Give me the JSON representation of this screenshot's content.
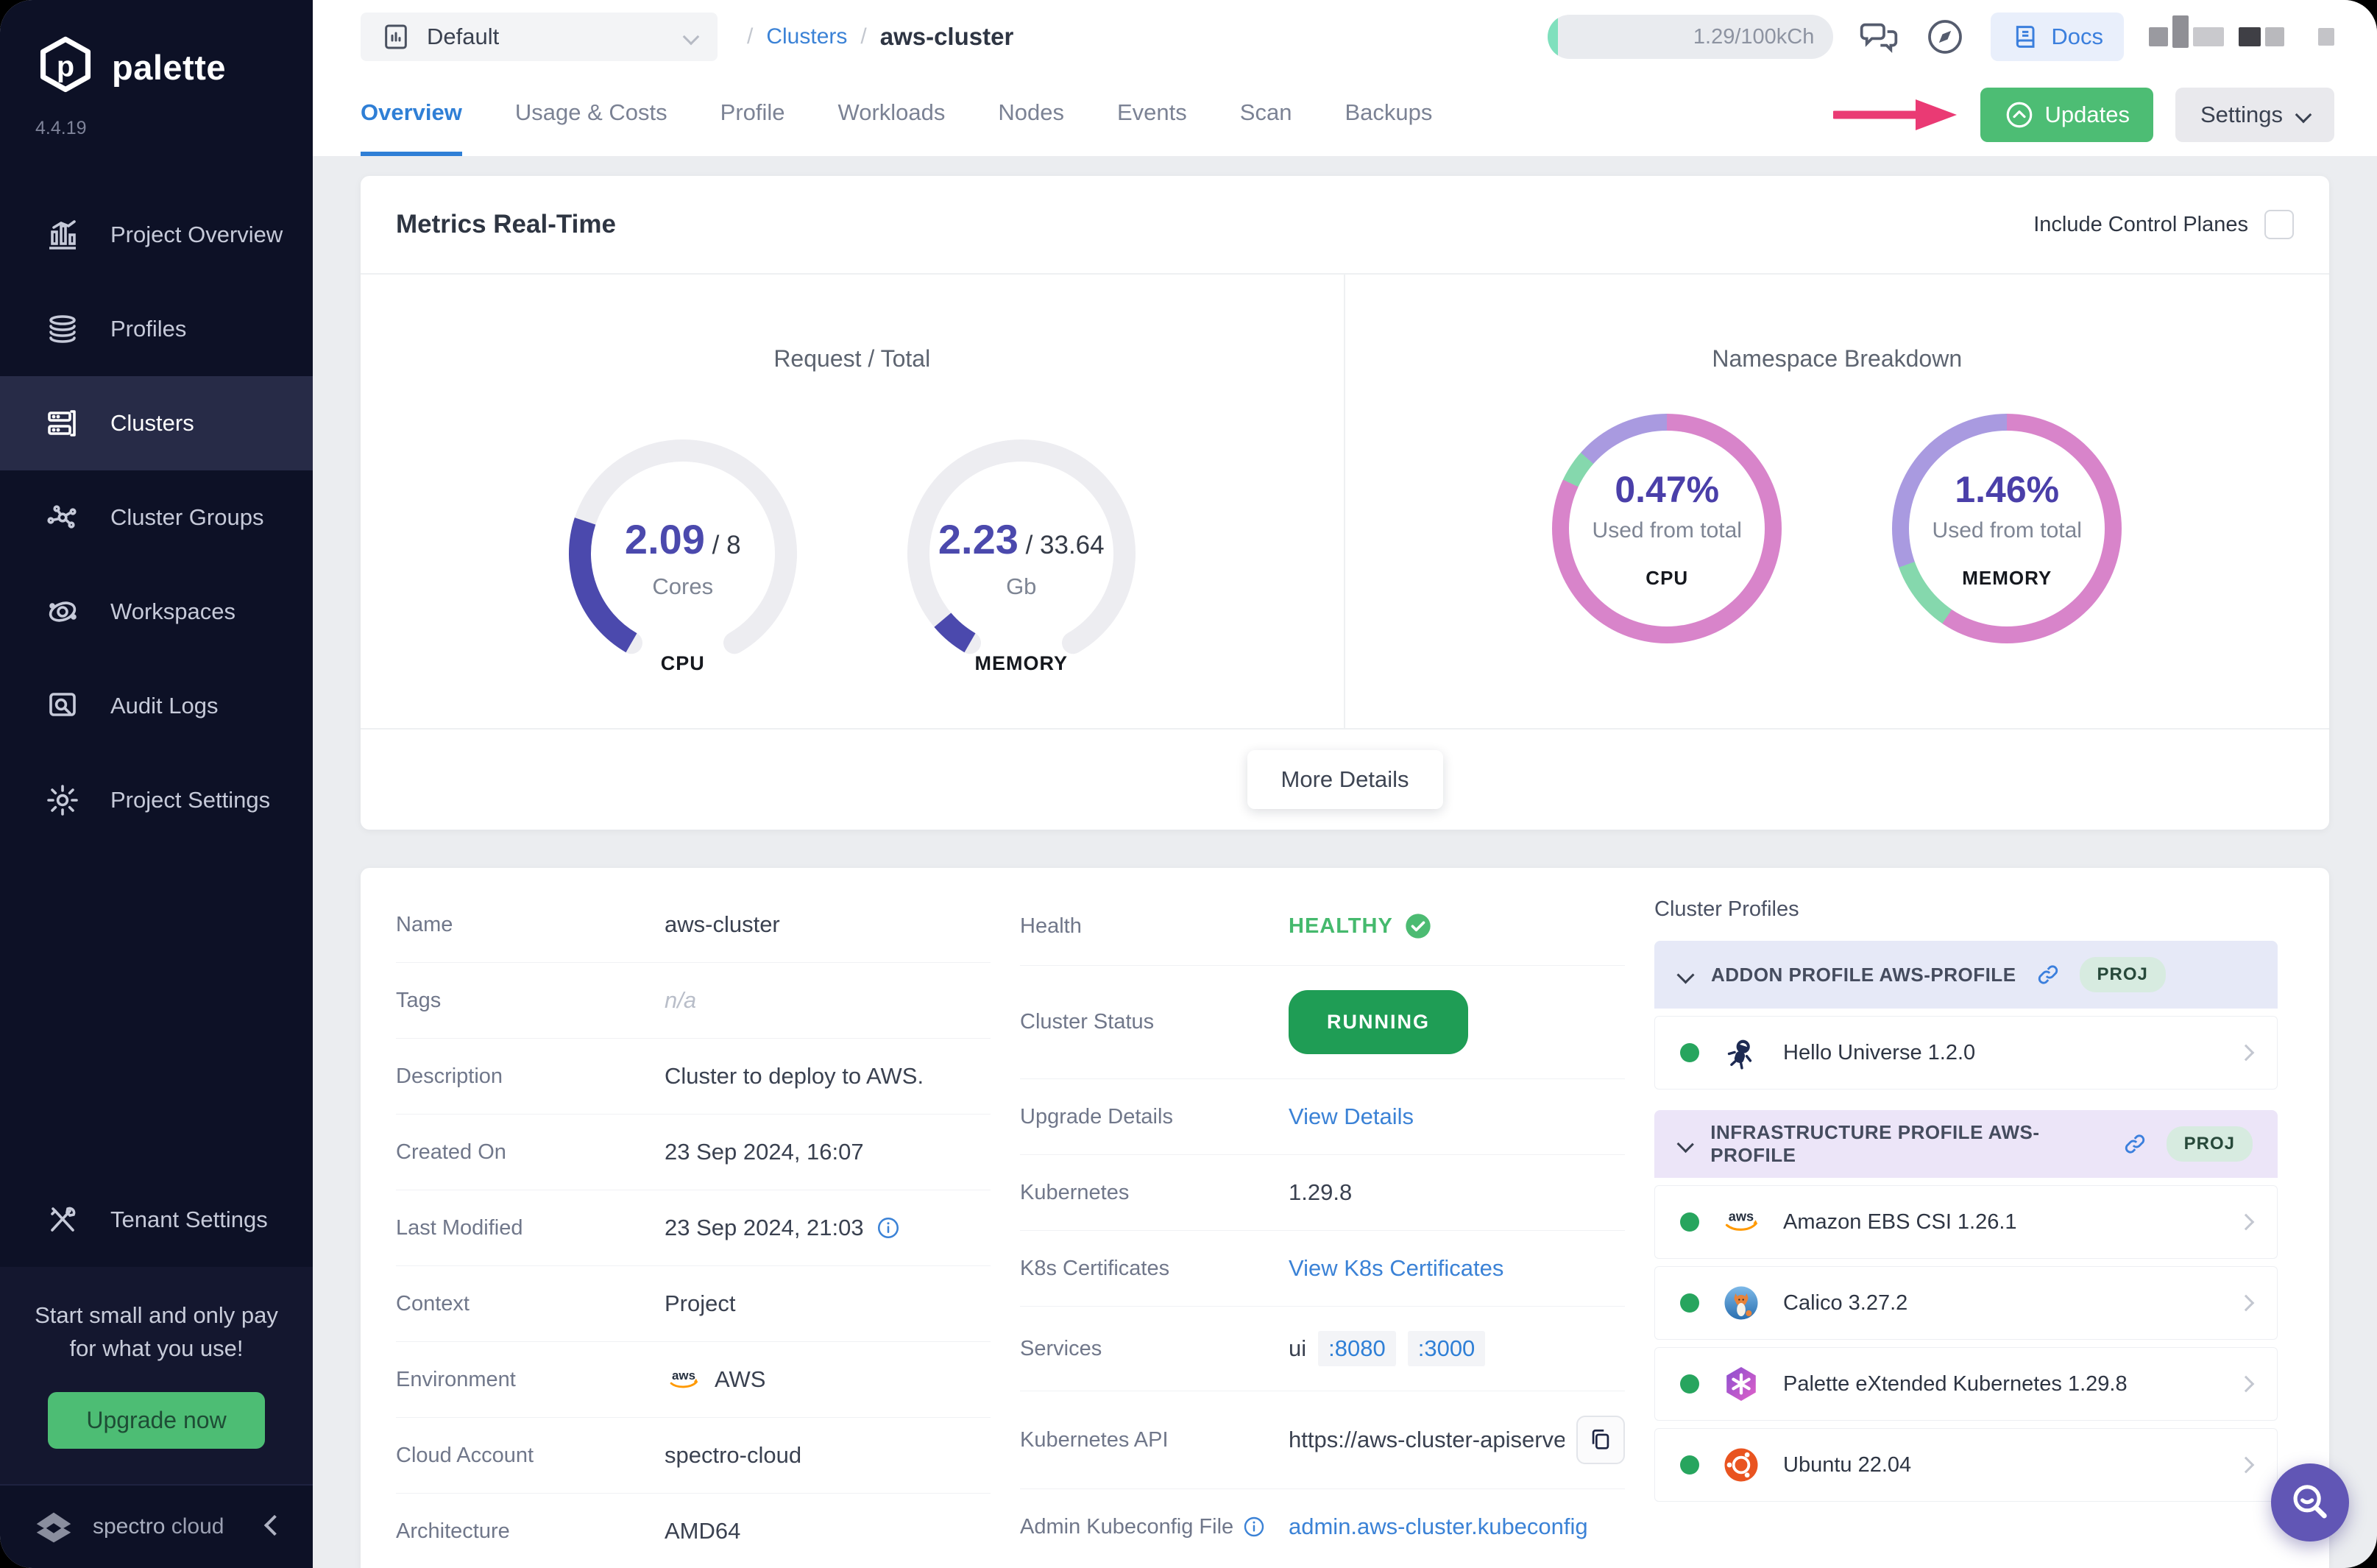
{
  "brand": {
    "name": "palette",
    "version": "4.4.19",
    "footer_primary": "spectro",
    "footer_secondary": "cloud"
  },
  "sidebar": {
    "items": [
      {
        "label": "Project Overview"
      },
      {
        "label": "Profiles"
      },
      {
        "label": "Clusters"
      },
      {
        "label": "Cluster Groups"
      },
      {
        "label": "Workspaces"
      },
      {
        "label": "Audit Logs"
      },
      {
        "label": "Project Settings"
      }
    ],
    "tenant_settings": "Tenant Settings",
    "promo": {
      "line1": "Start small and only pay",
      "line2": "for what you use!",
      "cta": "Upgrade now"
    }
  },
  "topbar": {
    "project_selector": "Default",
    "breadcrumb": {
      "sep": "/",
      "section": "Clusters",
      "current": "aws-cluster"
    },
    "usage_pill": "1.29/100kCh",
    "docs": "Docs"
  },
  "tabs": [
    "Overview",
    "Usage & Costs",
    "Profile",
    "Workloads",
    "Nodes",
    "Events",
    "Scan",
    "Backups"
  ],
  "actions": {
    "updates": "Updates",
    "settings": "Settings"
  },
  "metrics": {
    "title": "Metrics Real-Time",
    "include_control_planes": "Include Control Planes",
    "request_total": {
      "title": "Request / Total",
      "gauges": [
        {
          "value": 2.09,
          "total": 8,
          "value_str": "2.09",
          "total_str": " / 8",
          "unit": "Cores",
          "label": "CPU",
          "color": "#4b49ad"
        },
        {
          "value": 2.23,
          "total": 33.64,
          "value_str": "2.23",
          "total_str": " / 33.64",
          "unit": "Gb",
          "label": "MEMORY",
          "color": "#4b49ad"
        }
      ]
    },
    "namespace_breakdown": {
      "title": "Namespace Breakdown",
      "donuts": [
        {
          "percent": "0.47%",
          "caption": "Used from total",
          "label": "CPU",
          "segments": [
            {
              "color": "#d884ca",
              "from": 0,
              "to": 82
            },
            {
              "color": "#85d8ad",
              "from": 82,
              "to": 86.5
            },
            {
              "color": "#a99ae0",
              "from": 86.5,
              "to": 100
            }
          ]
        },
        {
          "percent": "1.46%",
          "caption": "Used from total",
          "label": "MEMORY",
          "segments": [
            {
              "color": "#d884ca",
              "from": 0,
              "to": 59.5
            },
            {
              "color": "#85d8ad",
              "from": 59.5,
              "to": 69.5
            },
            {
              "color": "#a99ae0",
              "from": 69.5,
              "to": 100
            }
          ]
        }
      ]
    },
    "more_details": "More Details"
  },
  "details": {
    "name": {
      "label": "Name",
      "value": "aws-cluster"
    },
    "tags": {
      "label": "Tags",
      "value": "n/a"
    },
    "description": {
      "label": "Description",
      "value": "Cluster to deploy to AWS."
    },
    "created_on": {
      "label": "Created On",
      "value": "23 Sep 2024, 16:07"
    },
    "last_modified": {
      "label": "Last Modified",
      "value": "23 Sep 2024, 21:03"
    },
    "context": {
      "label": "Context",
      "value": "Project"
    },
    "environment": {
      "label": "Environment",
      "value": "AWS"
    },
    "cloud_account": {
      "label": "Cloud Account",
      "value": "spectro-cloud"
    },
    "architecture": {
      "label": "Architecture",
      "value": "AMD64"
    }
  },
  "status": {
    "health": {
      "label": "Health",
      "value": "HEALTHY"
    },
    "cluster_status": {
      "label": "Cluster Status",
      "value": "RUNNING"
    },
    "upgrade": {
      "label": "Upgrade Details",
      "link": "View Details"
    },
    "kubernetes": {
      "label": "Kubernetes",
      "value": "1.29.8"
    },
    "certs": {
      "label": "K8s Certificates",
      "link": "View K8s Certificates"
    },
    "services": {
      "label": "Services",
      "prefix": "ui",
      "ports": [
        ":8080",
        ":3000"
      ]
    },
    "api": {
      "label": "Kubernetes API",
      "value": "https://aws-cluster-apiserve..."
    },
    "kubeconfig": {
      "label": "Admin Kubeconfig File",
      "link": "admin.aws-cluster.kubeconfig"
    }
  },
  "profiles": {
    "title": "Cluster Profiles",
    "groups": [
      {
        "header": "ADDON PROFILE AWS-PROFILE",
        "badge": "PROJ",
        "items": [
          {
            "name": "Hello Universe 1.2.0"
          }
        ]
      },
      {
        "header": "INFRASTRUCTURE PROFILE AWS-PROFILE",
        "badge": "PROJ",
        "items": [
          {
            "name": "Amazon EBS CSI 1.26.1"
          },
          {
            "name": "Calico 3.27.2"
          },
          {
            "name": "Palette eXtended Kubernetes 1.29.8"
          },
          {
            "name": "Ubuntu 22.04"
          }
        ]
      }
    ]
  }
}
